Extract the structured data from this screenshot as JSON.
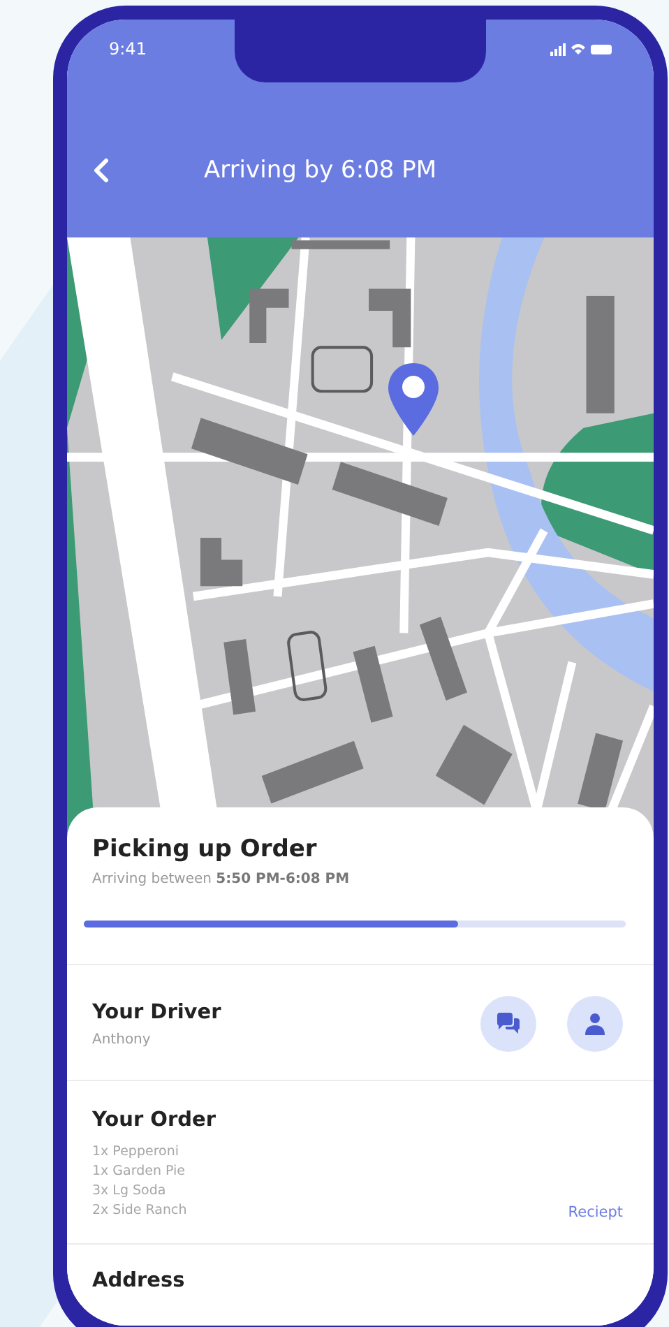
{
  "status_bar": {
    "time": "9:41"
  },
  "header": {
    "title": "Arriving by 6:08 PM"
  },
  "order_status": {
    "title": "Picking up Order",
    "subtitle": "Arriving between **5:50 PM-6:08 PM**",
    "progress": {
      "level": 0.69
    }
  },
  "driver": {
    "title": "Your Driver",
    "name": "Anthony"
  },
  "order": {
    "title": "Your Order",
    "items": [
      "1x Pepperoni",
      "1x Garden Pie",
      "3x Lg Soda",
      "2x Side Ranch"
    ],
    "receipt_link": "Reciept"
  },
  "address": {
    "title": "Address"
  }
}
